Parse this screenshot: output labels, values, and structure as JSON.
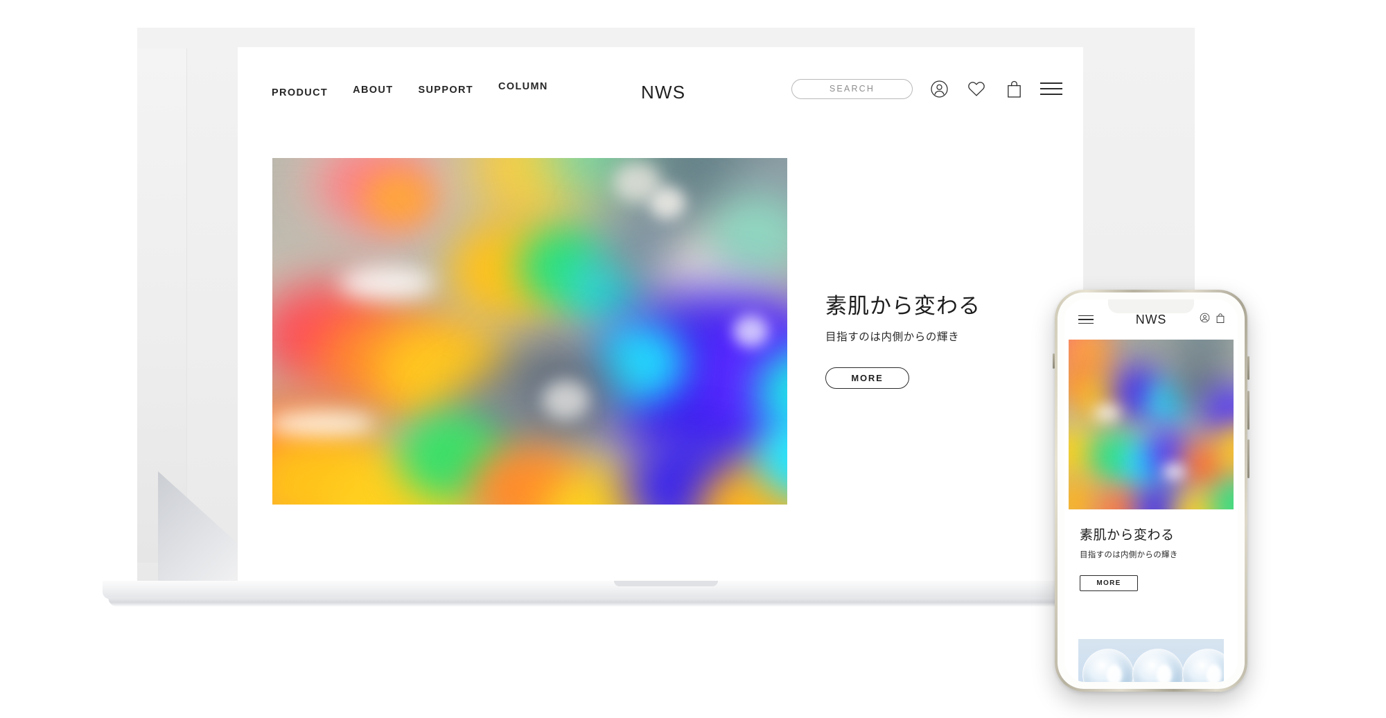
{
  "device_mockup": {
    "laptop_label": "laptop-mockup",
    "phone_label": "phone-mockup"
  },
  "desktop": {
    "nav": {
      "links": [
        {
          "label": "PRODUCT"
        },
        {
          "label": "ABOUT"
        },
        {
          "label": "SUPPORT"
        },
        {
          "label": "COLUMN"
        }
      ],
      "brand": "NWS",
      "search": {
        "placeholder": "SEARCH",
        "value": ""
      },
      "icons": [
        {
          "name": "account-icon"
        },
        {
          "name": "heart-icon"
        },
        {
          "name": "shopping-bag-icon"
        },
        {
          "name": "hamburger-menu-icon"
        }
      ]
    },
    "hero": {
      "image_alt": "holographic-iridescent-abstract",
      "title": "素肌から変わる",
      "subtitle": "目指すのは内側からの輝き",
      "cta_label": "MORE"
    }
  },
  "mobile": {
    "nav": {
      "brand": "NWS",
      "icons": [
        {
          "name": "hamburger-menu-icon"
        },
        {
          "name": "account-icon"
        },
        {
          "name": "shopping-bag-icon"
        }
      ]
    },
    "hero": {
      "image_alt": "holographic-iridescent-abstract",
      "title": "素肌から変わる",
      "subtitle": "目指すのは内側からの輝き",
      "cta_label": "MORE"
    },
    "next_section": {
      "image_alt": "water-droplets-blue"
    }
  },
  "colors": {
    "page_background": "#ffffff",
    "text_primary": "#1d1d1d",
    "text_muted": "#8d8d8d",
    "laptop_body": "#eeeeee",
    "phone_frame": "#cdc8b4",
    "droplet_panel": "#d7e4f0"
  }
}
